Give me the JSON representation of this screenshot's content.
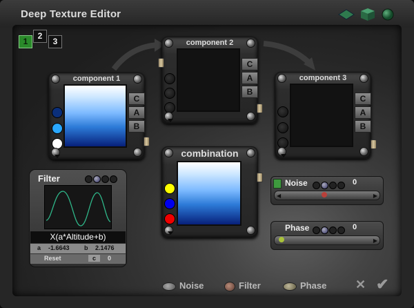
{
  "window": {
    "title": "Deep Texture Editor"
  },
  "tabs": [
    {
      "label": "1",
      "active": true
    },
    {
      "label": "2",
      "active": false
    },
    {
      "label": "3",
      "active": false
    }
  ],
  "components": {
    "c1": {
      "title": "component 1",
      "buttons": [
        "C",
        "A",
        "B"
      ],
      "dots": [
        "#0b2f7a",
        "#2aa8ff",
        "#ffffff"
      ]
    },
    "c2": {
      "title": "component 2",
      "buttons": [
        "C",
        "A",
        "B"
      ]
    },
    "c3": {
      "title": "component 3",
      "buttons": [
        "C",
        "A",
        "B"
      ]
    },
    "comb": {
      "title": "combination",
      "dots": [
        "#ffff00",
        "#0000ee",
        "#ee0000"
      ]
    }
  },
  "filter": {
    "title": "Filter",
    "formula": "X(a*Altitude+b)",
    "a_label": "a",
    "a_value": "-1.6643",
    "b_label": "b",
    "b_value": "2.1476",
    "reset_label": "Reset",
    "c_label": "c",
    "c_value": "0"
  },
  "noise": {
    "label": "Noise",
    "value": "0",
    "slider_fraction": 0.47
  },
  "phase": {
    "label": "Phase",
    "value": "0",
    "slider_fraction": 0.04
  },
  "bottom_bar": {
    "noise_label": "Noise",
    "filter_label": "Filter",
    "phase_label": "Phase"
  },
  "colors": {
    "accent_green": "#2a8a2a",
    "title_text": "#dcdcdc"
  },
  "icons": [
    "titlebar-diamond-icon",
    "titlebar-cube-icon",
    "titlebar-sphere-icon",
    "close-icon",
    "check-icon"
  ]
}
